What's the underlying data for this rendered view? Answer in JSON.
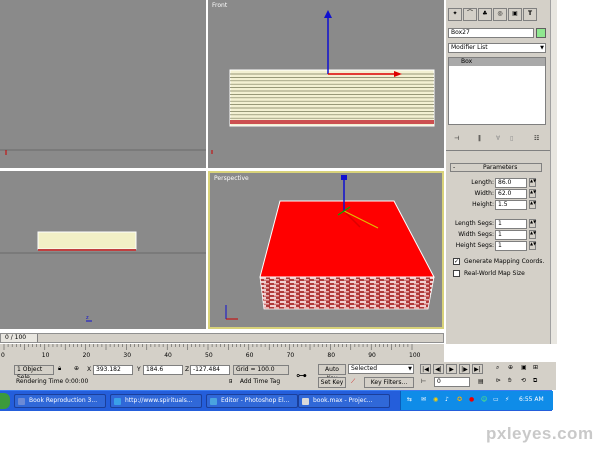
{
  "viewports": {
    "top": {
      "label": ""
    },
    "front": {
      "label": "Front"
    },
    "left": {
      "label": ""
    },
    "perspective": {
      "label": "Perspective"
    }
  },
  "command_panel": {
    "object_name": "Box27",
    "modifier_list": "Modifier List",
    "stack_item": "Box",
    "rollout_title": "Parameters",
    "params": [
      {
        "label": "Length:",
        "value": "86.0"
      },
      {
        "label": "Width:",
        "value": "62.0"
      },
      {
        "label": "Height:",
        "value": "1.5"
      }
    ],
    "segs": [
      {
        "label": "Length Segs:",
        "value": "1"
      },
      {
        "label": "Width Segs:",
        "value": "1"
      },
      {
        "label": "Height Segs:",
        "value": "1"
      }
    ],
    "generate_mapping": {
      "label": "Generate Mapping Coords.",
      "checked": true
    },
    "real_world": {
      "label": "Real-World Map Size",
      "checked": false
    }
  },
  "timeline": {
    "frame_counter": "0 / 100",
    "ticks": [
      "0",
      "10",
      "20",
      "30",
      "40",
      "50",
      "60",
      "70",
      "80",
      "90",
      "100"
    ]
  },
  "status": {
    "selection": "1 Object Sele",
    "x_label": "X",
    "x": "393.182",
    "y_label": "Y",
    "y": "184.6",
    "z_label": "Z",
    "z": "-127.484",
    "grid": "Grid = 100.0",
    "rendering": "Rendering Time  0:00:00",
    "add_time_tag": "Add Time Tag",
    "auto_key": "Auto Key",
    "set_key": "Set Key",
    "selected": "Selected",
    "key_filters": "Key Filters...",
    "frame": "0"
  },
  "taskbar": {
    "items": [
      {
        "label": "Book Reproduction 3...",
        "icon_color": "#6b8ad6"
      },
      {
        "label": "http://www.spirituals...",
        "icon_color": "#3aa0e8"
      },
      {
        "label": "Editor - Photoshop El...",
        "icon_color": "#4aa3df"
      },
      {
        "label": "book.max    - Projec...",
        "icon_color": "#d9d9d9"
      }
    ],
    "clock": "6:55 AM"
  },
  "watermark": "pxleyes.com",
  "colors": {
    "viewport_bg": "#8a8a8a",
    "book_red": "#e00000",
    "taskbar_blue": "#245edb",
    "active_border": "#d8d27a"
  }
}
